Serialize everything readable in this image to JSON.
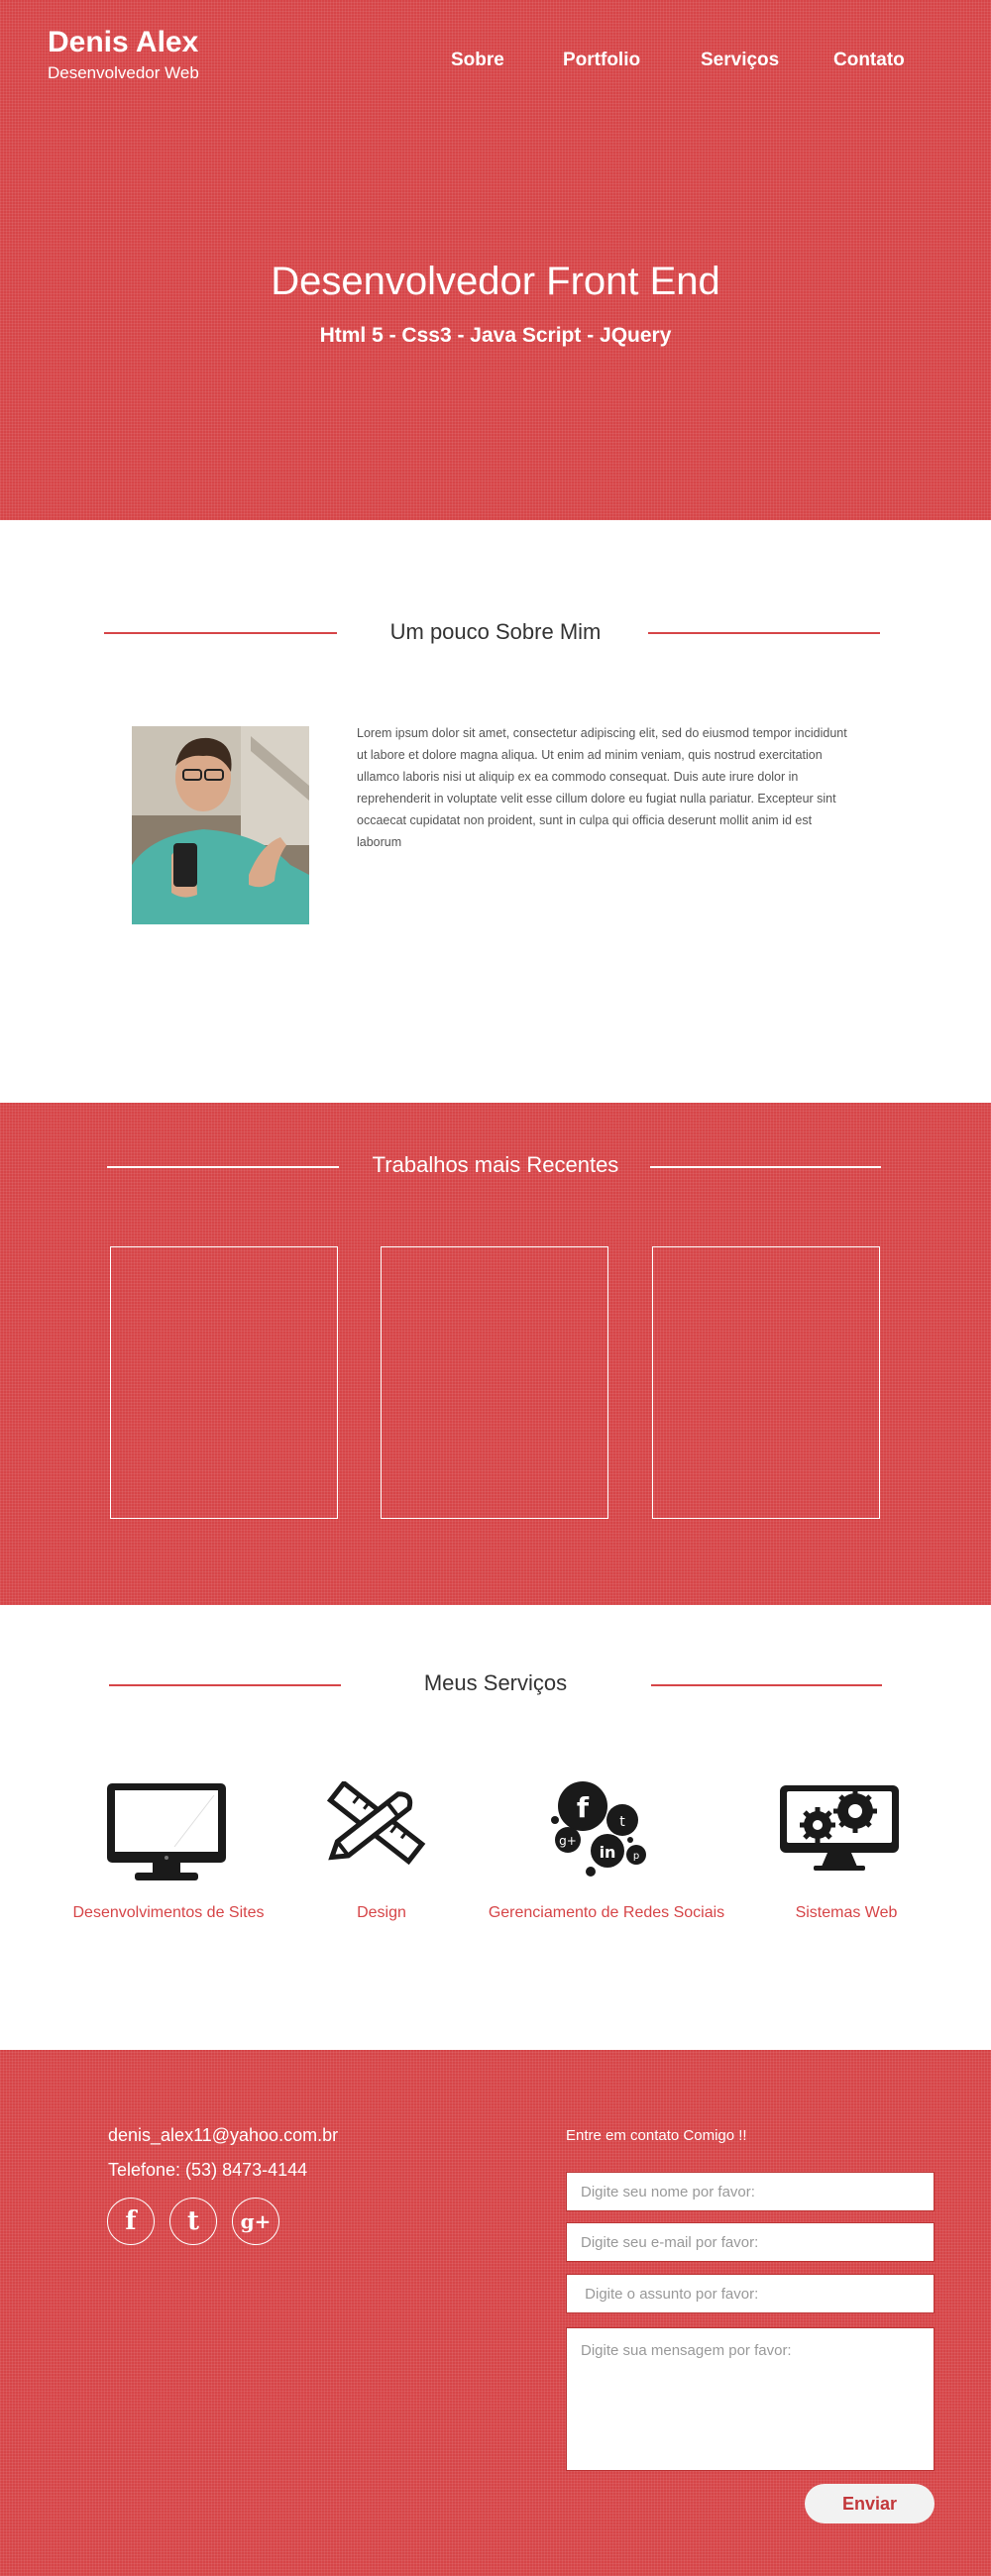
{
  "brand": {
    "name": "Denis Alex",
    "subtitle": "Desenvolvedor Web"
  },
  "nav": [
    {
      "label": "Sobre"
    },
    {
      "label": "Portfolio"
    },
    {
      "label": "Serviços"
    },
    {
      "label": "Contato"
    }
  ],
  "hero": {
    "title": "Desenvolvedor Front End",
    "subtitle": "Html 5 - Css3 - Java Script - JQuery"
  },
  "about": {
    "title": "Um pouco Sobre Mim",
    "text": "Lorem ipsum dolor sit amet, consectetur adipiscing elit, sed do eiusmod tempor incididunt ut labore et dolore magna aliqua. Ut enim ad minim veniam, quis nostrud exercitation ullamco laboris nisi ut aliquip ex ea commodo consequat. Duis aute irure dolor in reprehenderit in voluptate velit esse cillum dolore eu fugiat nulla pariatur. Excepteur sint occaecat cupidatat non proident, sunt in culpa qui officia deserunt mollit anim id est laborum"
  },
  "portfolio": {
    "title": "Trabalhos mais Recentes"
  },
  "services": {
    "title": "Meus Serviços",
    "items": [
      {
        "label": "Desenvolvimentos de Sites",
        "icon": "monitor-icon"
      },
      {
        "label": "Design",
        "icon": "pencil-ruler-icon"
      },
      {
        "label": "Gerenciamento de Redes Sociais",
        "icon": "social-bubbles-icon"
      },
      {
        "label": "Sistemas Web",
        "icon": "monitor-gears-icon"
      }
    ]
  },
  "footer": {
    "email": "denis_alex11@yahoo.com.br",
    "phone": "Telefone: (53) 8473-4144",
    "social": [
      {
        "icon": "facebook-icon",
        "glyph": "f"
      },
      {
        "icon": "twitter-icon",
        "glyph": "t"
      },
      {
        "icon": "google-plus-icon",
        "glyph": "g+"
      }
    ],
    "contact_title": "Entre em contato Comigo !!",
    "form": {
      "name_placeholder": "Digite seu nome por favor:",
      "email_placeholder": "Digite seu e-mail por favor:",
      "subject_placeholder": " Digite o assunto por favor:",
      "message_placeholder": "Digite sua mensagem por favor:",
      "send_label": "Enviar"
    }
  },
  "colors": {
    "accent": "#d64548",
    "white": "#ffffff",
    "text": "#333333"
  }
}
